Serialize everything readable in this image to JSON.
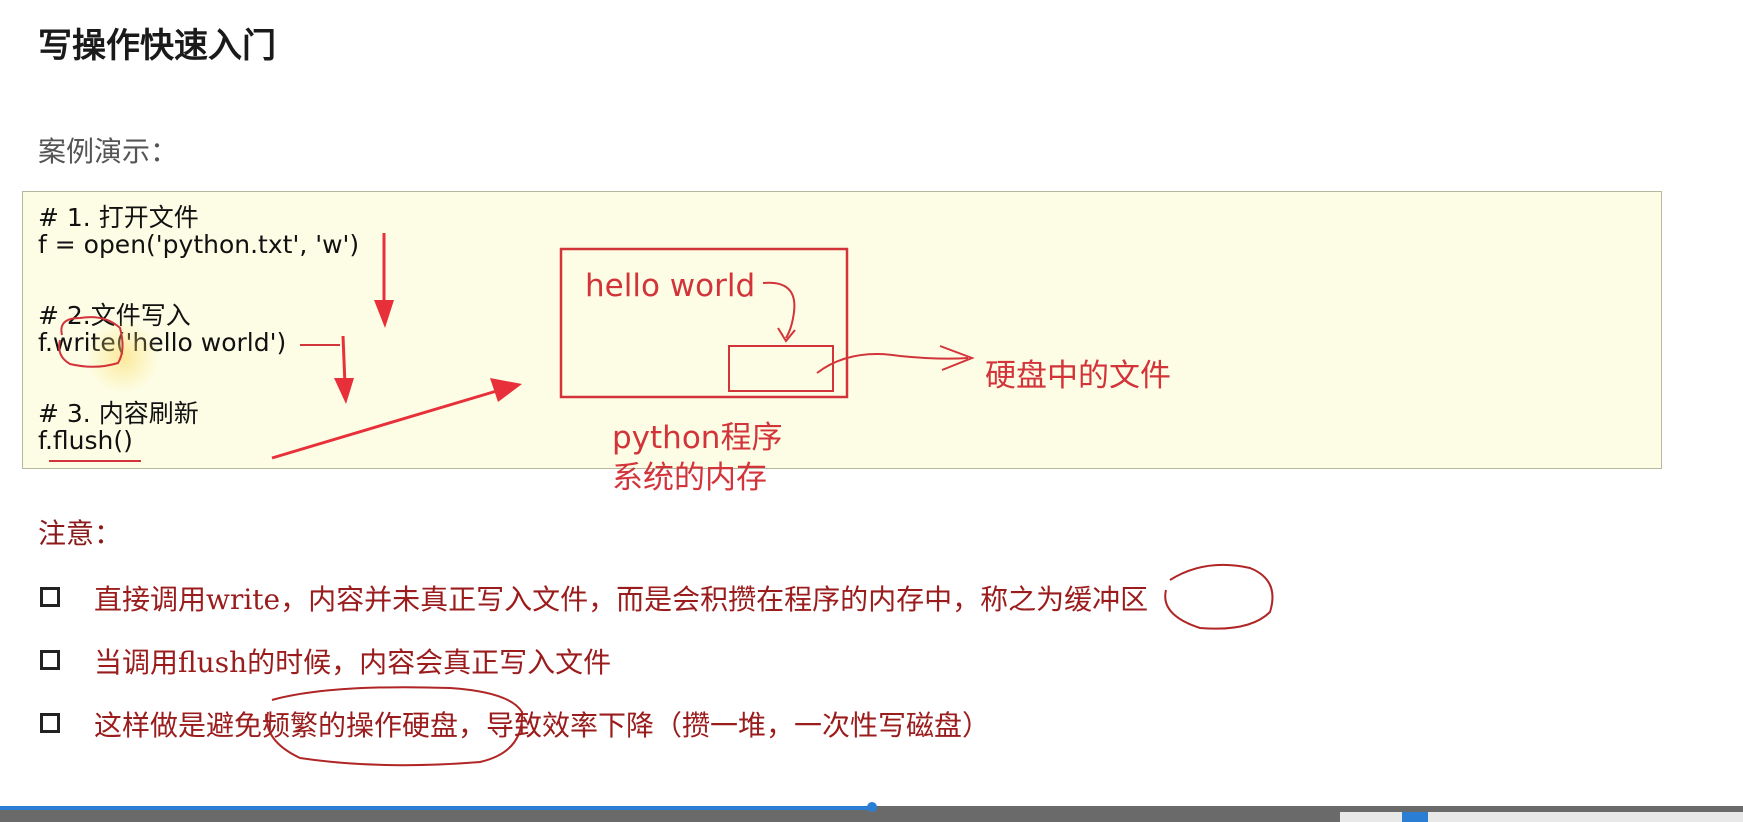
{
  "slide": {
    "title": "写操作快速入门",
    "subtitle": "案例演示："
  },
  "code": {
    "lines": [
      "# 1. 打开文件",
      "f = open('python.txt', 'w')",
      "# 2.文件写入",
      "f.write('hello world')",
      "# 3. 内容刷新",
      "f.flush()"
    ]
  },
  "annotations": {
    "hello_world": "hello world",
    "disk_file": "硬盘中的文件",
    "program_line1": "python程序",
    "program_line2": "系统的内存",
    "color": "#d2343a"
  },
  "notes": {
    "heading": "注意：",
    "items": [
      "直接调用write，内容并未真正写入文件，而是会积攒在程序的内存中，称之为缓冲区",
      "当调用flush的时候，内容会真正写入文件",
      "这样做是避免频繁的操作硬盘，导致效率下降（攒一堆，一次性写磁盘）"
    ]
  },
  "player": {
    "progress": 0.5
  }
}
